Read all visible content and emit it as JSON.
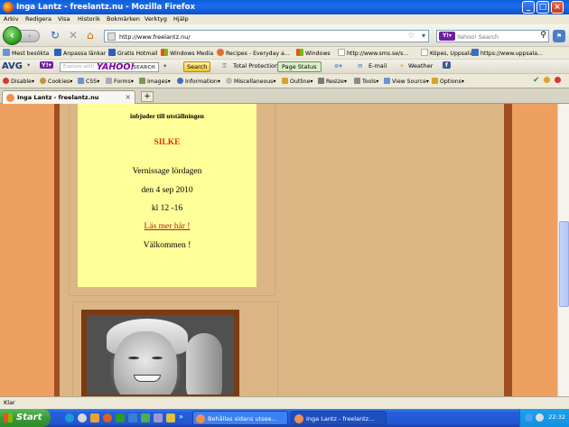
{
  "window": {
    "title": "Inga Lantz - freelantz.nu - Mozilla Firefox"
  },
  "menu": [
    "Arkiv",
    "Redigera",
    "Visa",
    "Historik",
    "Bokmärken",
    "Verktyg",
    "Hjälp"
  ],
  "nav": {
    "url": "http://www.freelantz.nu/",
    "search_placeholder": "Yahoo! Search"
  },
  "bookmarks": [
    "Mest besökta",
    "Anpassa länkar",
    "Gratis Hotmail",
    "Windows Media",
    "Recipes - Everyday a...",
    "Windows",
    "http://www.sms.se/s...",
    "Köpes, Uppsala",
    "https://www.uppsala..."
  ],
  "avg_toolbar": {
    "logo": "AVG",
    "yahoo_placeholder": "Explore with",
    "yahoo_logo": "YAHOO!",
    "yahoo_search_label": "SEARCH",
    "search_button": "Search",
    "total_protection": "Total Protection",
    "page_status": "Page Status",
    "email": "E-mail",
    "weather": "Weather"
  },
  "dev_toolbar": [
    "Disable",
    "Cookies",
    "CSS",
    "Forms",
    "Images",
    "Information",
    "Miscellaneous",
    "Outline",
    "Resize",
    "Tools",
    "View Source",
    "Options"
  ],
  "tab": {
    "label": "Inga Lantz - freelantz.nu"
  },
  "page": {
    "intro": "inbjuder till utställningen",
    "exhibition": "SILKE",
    "vernissage": "Vernissage lördagen",
    "date": "den 4 sep 2010",
    "time": "kl 12 -16",
    "read_more": "Läs mer här !",
    "welcome": "Välkommen !"
  },
  "status": {
    "text": "Klar"
  },
  "taskbar": {
    "start": "Start",
    "tasks": [
      "Behållas sidans utsee...",
      "Inga Lantz - freelantz..."
    ],
    "clock": "22:32"
  },
  "colors": {
    "page_bg": "#dcb585",
    "outer": "#eea060",
    "frame": "#9e4e22",
    "notice_bg": "#ffff99",
    "title_red": "#e03010"
  }
}
